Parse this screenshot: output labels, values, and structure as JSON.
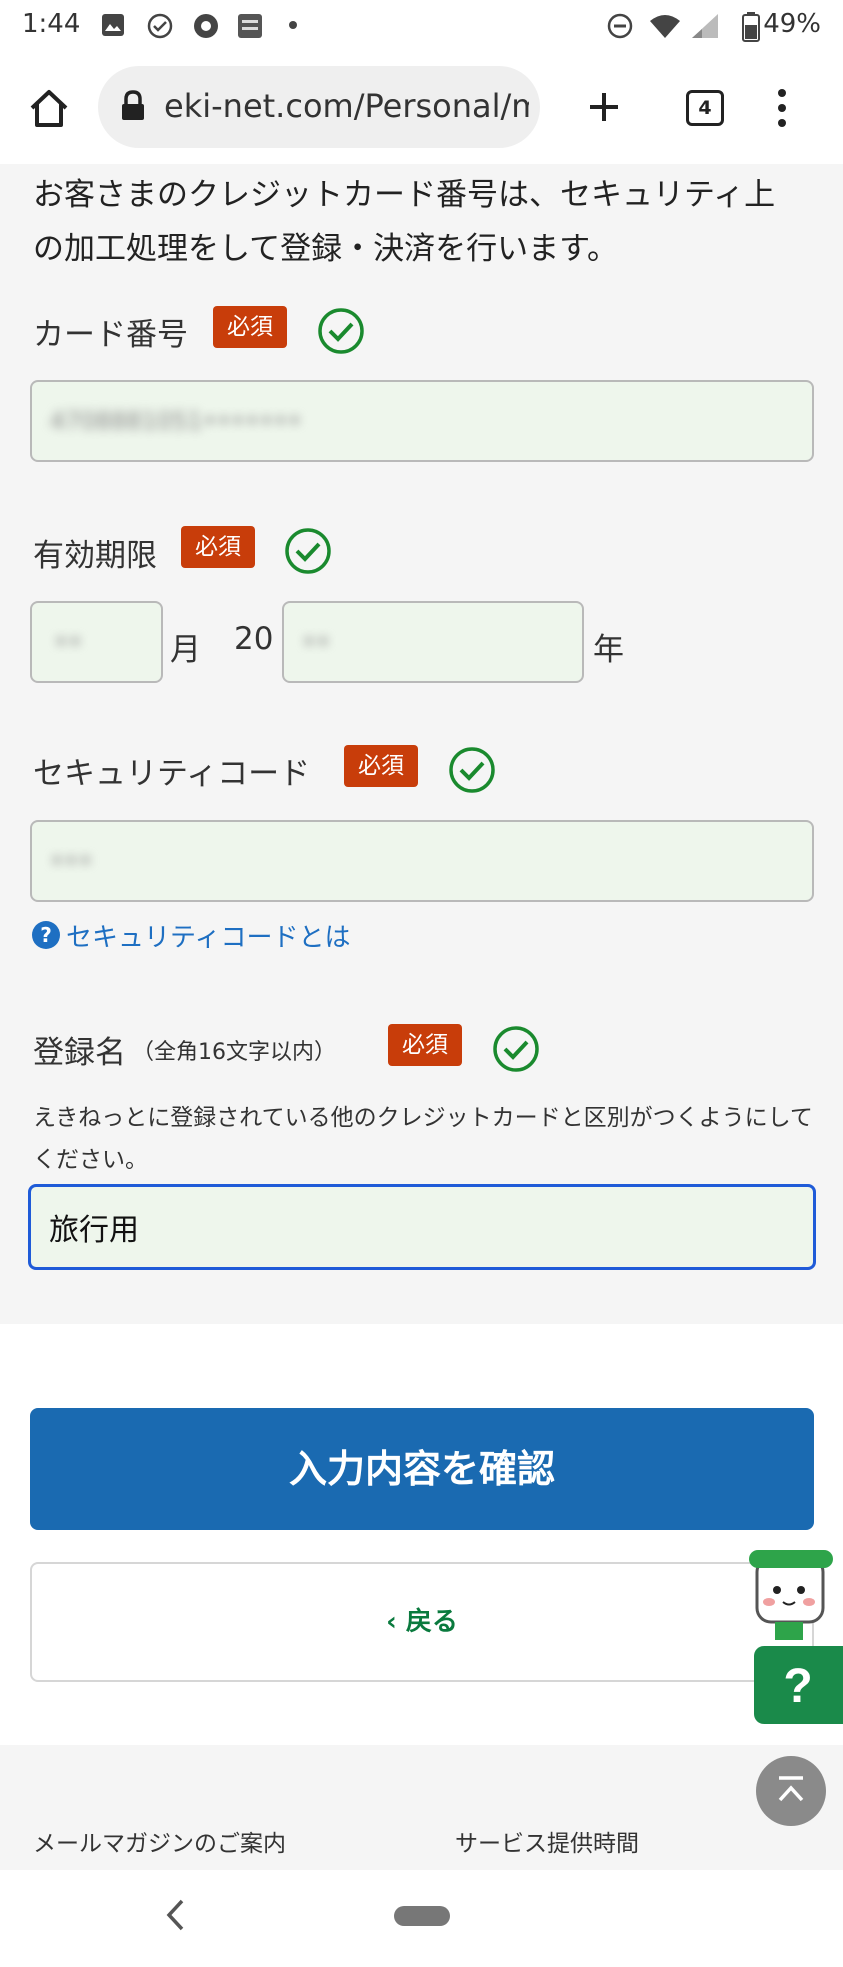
{
  "status_bar": {
    "time": "1:44",
    "battery": "49%",
    "left_icons": [
      "image-icon",
      "check-circle-icon",
      "chrome-icon",
      "app-icon",
      "dot-icon"
    ],
    "right_icons": [
      "dnd-icon",
      "wifi-icon",
      "signal-icon",
      "battery-icon"
    ]
  },
  "browser": {
    "url": "eki-net.com/Personal/me",
    "tab_count": "4"
  },
  "form": {
    "intro": "お客さまのクレジットカード番号は、セキュリティ上の加工処理をして登録・決済を行います。",
    "required_badge": "必須",
    "card_number": {
      "label": "カード番号",
      "value": "4708881051•••••••"
    },
    "expiry": {
      "label": "有効期限",
      "month_value": "••",
      "month_unit": "月",
      "year_prefix": "20",
      "year_value": "••",
      "year_unit": "年"
    },
    "security_code": {
      "label": "セキュリティコード",
      "value": "•••",
      "help_link": "セキュリティコードとは"
    },
    "registration_name": {
      "label": "登録名",
      "note": "（全角16文字以内）",
      "description": "えきねっとに登録されている他のクレジットカードと区別がつくようにしてください。",
      "value": "旅行用"
    }
  },
  "buttons": {
    "confirm": "入力内容を確認",
    "back": "戻る"
  },
  "footer": {
    "links": [
      "メールマガジンのご案内",
      "サービス提供時間"
    ]
  },
  "colors": {
    "required": "#c83d0a",
    "primary": "#1a6ab1",
    "valid_check": "#1a8a2e",
    "link": "#1e6fc2",
    "back_text": "#0a7a3e"
  }
}
